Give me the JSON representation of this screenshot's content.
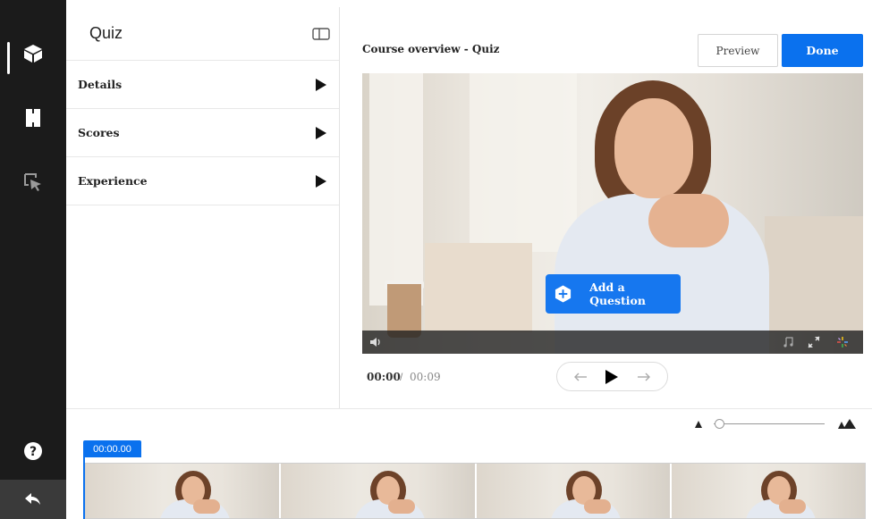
{
  "panel": {
    "title": "Quiz",
    "items": [
      {
        "label": "Details"
      },
      {
        "label": "Scores"
      },
      {
        "label": "Experience"
      }
    ]
  },
  "header": {
    "video_title": "Course overview - Quiz",
    "preview_label": "Preview",
    "done_label": "Done"
  },
  "video": {
    "add_question_label": "Add a Question"
  },
  "transport": {
    "current_time": "00:00",
    "separator": "/",
    "total_time": "00:09"
  },
  "timeline": {
    "timecode": "00:00.00",
    "zoom_level": 0.05
  },
  "icons": {
    "rail": [
      "cube-icon",
      "book-icon",
      "cursor-select-icon",
      "help-icon",
      "back-arrow-icon"
    ],
    "panel_toggle": "panel-toggle-icon"
  },
  "colors": {
    "accent": "#0a71ee",
    "rail_bg": "#1b1b1b"
  }
}
